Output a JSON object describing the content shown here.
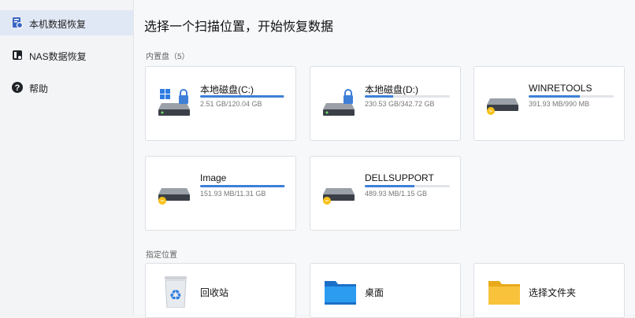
{
  "sidebar": {
    "items": [
      {
        "label": "本机数据恢复",
        "icon": "computer-file-icon",
        "active": true
      },
      {
        "label": "NAS数据恢复",
        "icon": "nas-icon",
        "active": false
      },
      {
        "label": "帮助",
        "icon": "help-icon",
        "active": false
      }
    ]
  },
  "main": {
    "title": "选择一个扫描位置，开始恢复数据",
    "refresh_icon": "refresh-icon",
    "drives_section": "内置盘（5）",
    "locations_section": "指定位置",
    "drives": [
      {
        "name": "本地磁盘(C:)",
        "size": "2.51 GB/120.04 GB",
        "used": 0.98,
        "icon": "windows-locked-drive-icon"
      },
      {
        "name": "本地磁盘(D:)",
        "size": "230.53 GB/342.72 GB",
        "used": 0.33,
        "icon": "locked-drive-icon"
      },
      {
        "name": "WINRETOOLS",
        "size": "391.93 MB/990 MB",
        "used": 0.6,
        "icon": "warning-drive-icon"
      },
      {
        "name": "Image",
        "size": "151.93 MB/11.31 GB",
        "used": 0.99,
        "icon": "warning-drive-icon"
      },
      {
        "name": "DELLSUPPORT",
        "size": "489.93 MB/1.15 GB",
        "used": 0.58,
        "icon": "warning-drive-icon"
      }
    ],
    "locations": [
      {
        "name": "回收站",
        "icon": "recycle-bin-icon"
      },
      {
        "name": "桌面",
        "icon": "desktop-folder-icon"
      },
      {
        "name": "选择文件夹",
        "icon": "folder-icon"
      }
    ]
  }
}
